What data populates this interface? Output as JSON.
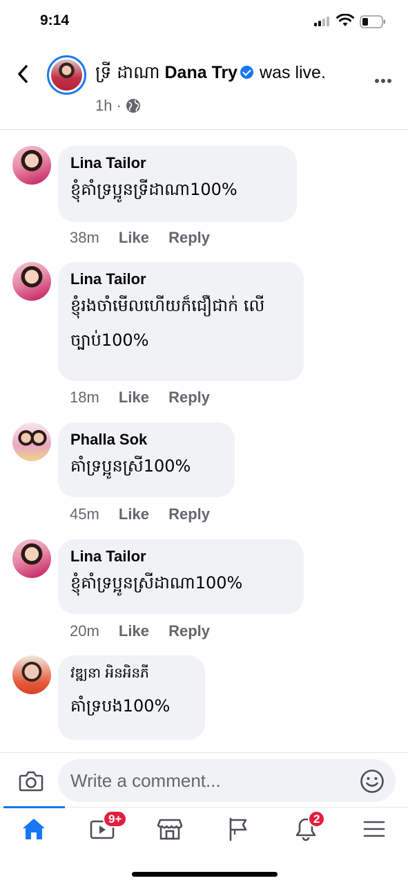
{
  "status_bar": {
    "time": "9:14"
  },
  "header": {
    "author_khmer": "ទ្រី ដាណា",
    "author_latin": "Dana Try",
    "action": "was live.",
    "time": "1h",
    "separator": "·"
  },
  "comments": [
    {
      "author": "Lina Tailor",
      "text": "ខ្ញុំគាំទ្រប្អូនទ្រីដាណា100%",
      "time": "38m",
      "like": "Like",
      "reply": "Reply"
    },
    {
      "author": "Lina Tailor",
      "text": "ខ្ញុំរងចាំមើលហើយក៏ជឿជាក់ លើច្បាប់100%",
      "time": "18m",
      "like": "Like",
      "reply": "Reply"
    },
    {
      "author": "Phalla Sok",
      "text": "គាំទ្រប្អូនស្រី100%",
      "time": "45m",
      "like": "Like",
      "reply": "Reply"
    },
    {
      "author": "Lina Tailor",
      "text": "ខ្ញុំគាំទ្រប្អូនស្រីដាណា100%",
      "time": "20m",
      "like": "Like",
      "reply": "Reply"
    },
    {
      "author": "វឌ្ឍនា អិនអិនភី",
      "text": "គាំទ្របង100%"
    }
  ],
  "composer": {
    "placeholder": "Write a comment..."
  },
  "tab_bar": {
    "items": [
      {
        "icon": "home-icon",
        "active": true
      },
      {
        "icon": "video-icon",
        "badge": "9+"
      },
      {
        "icon": "marketplace-icon"
      },
      {
        "icon": "pages-flag-icon"
      },
      {
        "icon": "notifications-bell-icon",
        "badge": "2"
      },
      {
        "icon": "menu-icon"
      }
    ]
  },
  "colors": {
    "accent": "#1877f2",
    "badge": "#e41e3f",
    "bubble": "#f0f2f5",
    "meta": "#65676b"
  }
}
